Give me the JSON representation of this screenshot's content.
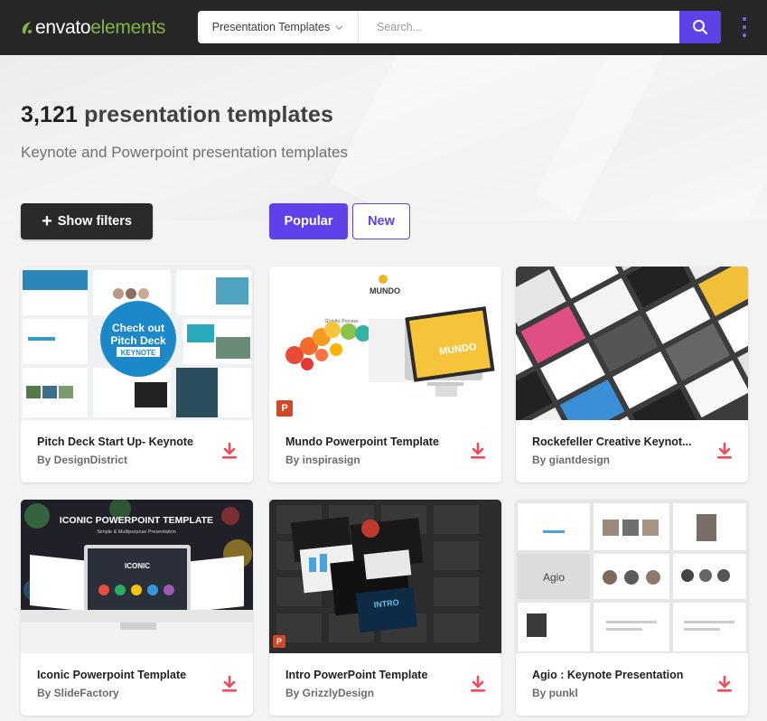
{
  "header": {
    "logo_main": "envato",
    "logo_accent": "elements",
    "category": "Presentation Templates",
    "search_placeholder": "Search..."
  },
  "hero": {
    "count": "3,121",
    "title_rest": " presentation templates",
    "subtitle": "Keynote and Powerpoint presentation templates"
  },
  "controls": {
    "filters_label": "Show filters",
    "sort_popular": "Popular",
    "sort_new": "New"
  },
  "cards": [
    {
      "title": "Pitch Deck Start Up- Keynote",
      "author": "By DesignDistrict",
      "badge_line1": "Check out",
      "badge_line2": "Pitch Deck",
      "badge_line3": "KEYNOTE"
    },
    {
      "title": "Mundo Powerpoint Template",
      "author": "By inspirasign",
      "brand": "MUNDO",
      "small": "Graphic Process"
    },
    {
      "title": "Rockefeller Creative Keynot...",
      "author": "By giantdesign"
    },
    {
      "title": "Iconic Powerpoint Template",
      "author": "By SlideFactory",
      "banner": "ICONIC POWERPOINT TEMPLATE",
      "banner_sub": "Simple & Multipurpose Presentation",
      "screen": "ICONIC"
    },
    {
      "title": "Intro PowerPoint Template",
      "author": "By GrizzlyDesign",
      "screen": "INTRO"
    },
    {
      "title": "Agio : Keynote Presentation",
      "author": "By punkl",
      "brand": "Agio"
    }
  ],
  "colors": {
    "accent": "#5e41e8",
    "download": "#ef4a5e",
    "topbar": "#262626",
    "logo_green": "#82b541"
  }
}
